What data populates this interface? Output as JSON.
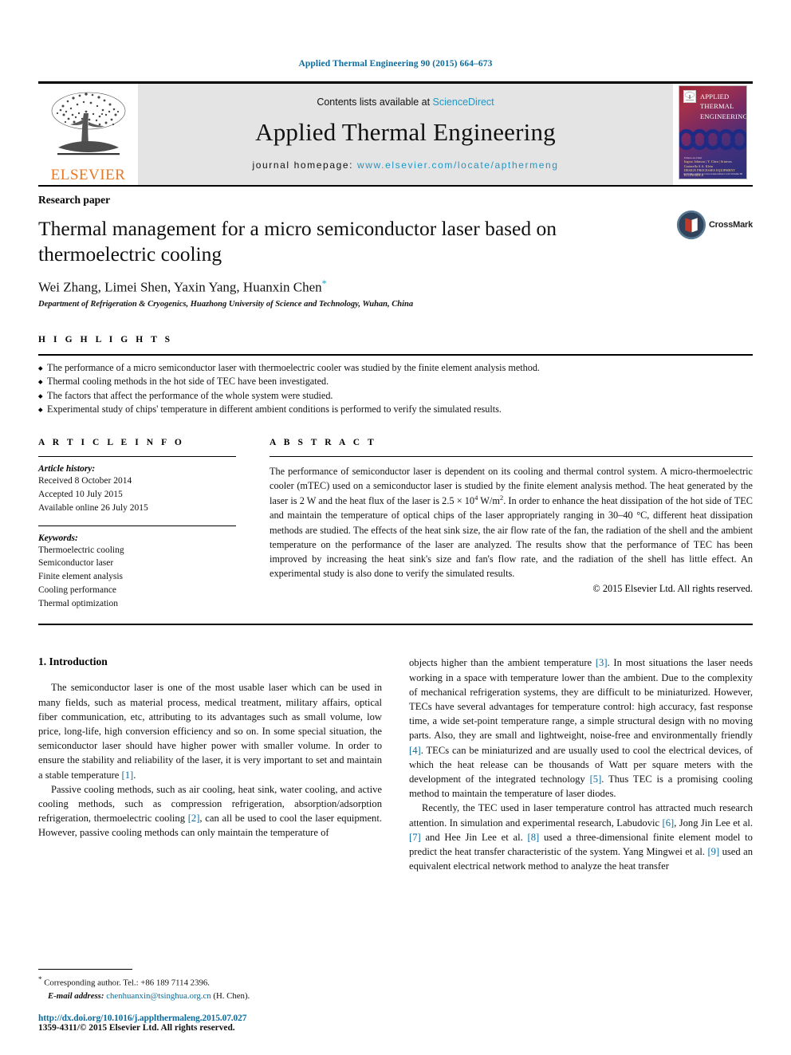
{
  "running_head": "Applied Thermal Engineering 90 (2015) 664–673",
  "masthead": {
    "publisher": "ELSEVIER",
    "contents_prefix": "Contents lists available at ",
    "contents_link": "ScienceDirect",
    "journal_title": "Applied Thermal Engineering",
    "homepage_prefix": "journal homepage: ",
    "homepage_url": "www.elsevier.com/locate/apthermeng",
    "cover": {
      "line1": "APPLIED",
      "line2": "THERMAL",
      "line3": "ENGINEERING",
      "elsevier_mark": "ELSEVIER",
      "editors_label": "Editors-in-Chief",
      "editors": "Ingvar Johnson  |  Y. Chen  |  Srinivas Garimella  S.A. Klein",
      "topics": "DESIGN   PROCESSES   EQUIPMENT   ECONOMICS",
      "bottom": "Available online at www.sciencedirect.com  Volume 90"
    }
  },
  "article": {
    "type": "Research paper",
    "title": "Thermal management for a micro semiconductor laser based on thermoelectric cooling",
    "authors": "Wei Zhang, Limei Shen, Yaxin Yang, Huanxin Chen",
    "corresponding_marker": "*",
    "affiliation": "Department of Refrigeration & Cryogenics, Huazhong University of Science and Technology, Wuhan, China",
    "crossmark_label": "CrossMark"
  },
  "highlights": {
    "heading": "H I G H L I G H T S",
    "items": [
      "The performance of a micro semiconductor laser with thermoelectric cooler was studied by the finite element analysis method.",
      "Thermal cooling methods in the hot side of TEC have been investigated.",
      "The factors that affect the performance of the whole system were studied.",
      "Experimental study of chips' temperature in different ambient conditions is performed to verify the simulated results."
    ]
  },
  "article_info": {
    "heading": "A R T I C L E   I N F O",
    "history_label": "Article history:",
    "history": [
      "Received 8 October 2014",
      "Accepted 10 July 2015",
      "Available online 26 July 2015"
    ],
    "keywords_label": "Keywords:",
    "keywords": [
      "Thermoelectric cooling",
      "Semiconductor laser",
      "Finite element analysis",
      "Cooling performance",
      "Thermal optimization"
    ]
  },
  "abstract": {
    "heading": "A B S T R A C T",
    "part1": "The performance of semiconductor laser is dependent on its cooling and thermal control system. A micro-thermoelectric cooler (mTEC) used on a semiconductor laser is studied by the finite element analysis method. The heat generated by the laser is 2 W and the heat flux of the laser is 2.5 × 10",
    "sup1": "4",
    "part2": " W/m",
    "sup2": "2",
    "part3": ". In order to enhance the heat dissipation of the hot side of TEC and maintain the temperature of optical chips of the laser appropriately ranging in 30–40 °C, different heat dissipation methods are studied. The effects of the heat sink size, the air flow rate of the fan, the radiation of the shell and the ambient temperature on the performance of the laser are analyzed. The results show that the performance of TEC has been improved by increasing the heat sink's size and fan's flow rate, and the radiation of the shell has little effect. An experimental study is also done to verify the simulated results.",
    "copyright": "© 2015 Elsevier Ltd. All rights reserved."
  },
  "body": {
    "section_number_title": "1. Introduction",
    "left_paragraphs": [
      "The semiconductor laser is one of the most usable laser which can be used in many fields, such as material process, medical treatment, military affairs, optical fiber communication, etc, attributing to its advantages such as small volume, low price, long-life, high conversion efficiency and so on. In some special situation, the semiconductor laser should have higher power with smaller volume. In order to ensure the stability and reliability of the laser, it is very important to set and maintain a stable temperature [1].",
      "Passive cooling methods, such as air cooling, heat sink, water cooling, and active cooling methods, such as compression refrigeration, absorption/adsorption refrigeration, thermoelectric cooling [2], can all be used to cool the laser equipment. However, passive cooling methods can only maintain the temperature of"
    ],
    "right_paragraphs": [
      "objects higher than the ambient temperature [3]. In most situations the laser needs working in a space with temperature lower than the ambient. Due to the complexity of mechanical refrigeration systems, they are difficult to be miniaturized. However, TECs have several advantages for temperature control: high accuracy, fast response time, a wide set-point temperature range, a simple structural design with no moving parts. Also, they are small and lightweight, noise-free and environmentally friendly [4]. TECs can be miniaturized and are usually used to cool the electrical devices, of which the heat release can be thousands of Watt per square meters with the development of the integrated technology [5]. Thus TEC is a promising cooling method to maintain the temperature of laser diodes.",
      "Recently, the TEC used in laser temperature control has attracted much research attention. In simulation and experimental research, Labudovic [6], Jong Jin Lee et al. [7] and Hee Jin Lee et al. [8] used a three-dimensional finite element model to predict the heat transfer characteristic of the system. Yang Mingwei et al. [9] used an equivalent electrical network method to analyze the heat transfer"
    ]
  },
  "footnote": {
    "corresponding_marker": "*",
    "corresponding_text": "Corresponding author. Tel.: +86 189 7114 2396.",
    "email_label": "E-mail address:",
    "email": "chenhuanxin@tsinghua.org.cn",
    "email_suffix": "(H. Chen).",
    "doi": "http://dx.doi.org/10.1016/j.applthermaleng.2015.07.027",
    "issn": "1359-4311/© 2015 Elsevier Ltd. All rights reserved."
  },
  "colors": {
    "link_blue": "#0b6b9c",
    "sciencedirect_blue": "#2196c4",
    "elsevier_orange": "#e87722"
  }
}
